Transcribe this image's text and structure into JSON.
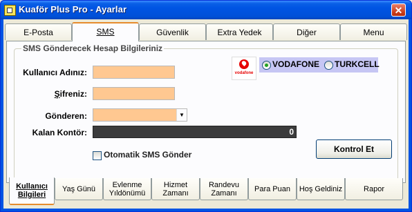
{
  "window": {
    "title": "Kuaför Plus Pro - Ayarlar",
    "close_glyph": "✕"
  },
  "top_tabs": [
    {
      "label": "E-Posta"
    },
    {
      "label": "SMS"
    },
    {
      "label": "Güvenlik"
    },
    {
      "label": "Extra Yedek"
    },
    {
      "label": "Diğer"
    },
    {
      "label": "Menu"
    }
  ],
  "sms": {
    "group_title": "SMS Gönderecek Hesap Bilgileriniz",
    "username_label": "Kullanıcı Adınız:",
    "username_value": "",
    "password_label": "Şifreniz:",
    "password_value": "",
    "sender_label": "Gönderen:",
    "sender_value": "",
    "balance_label": "Kalan Kontör:",
    "balance_value": "0",
    "auto_send_label": "Otomatik SMS Gönder",
    "auto_send_checked": false,
    "operator_logo_text": "vodafone",
    "operators": [
      {
        "label": "VODAFONE",
        "selected": true
      },
      {
        "label": "TURKCELL",
        "selected": false
      }
    ],
    "check_button_label": "Kontrol Et"
  },
  "bottom_tabs": [
    {
      "line1": "Kullanıcı",
      "line2": "Bilgileri"
    },
    {
      "line1": "Yaş Günü",
      "line2": ""
    },
    {
      "line1": "Evlenme",
      "line2": "Yıldönümü"
    },
    {
      "line1": "Hizmet",
      "line2": "Zamanı"
    },
    {
      "line1": "Randevu",
      "line2": "Zamanı"
    },
    {
      "line1": "Para Puan",
      "line2": ""
    },
    {
      "line1": "Hoş Geldiniz",
      "line2": ""
    },
    {
      "line1": "Rapor",
      "line2": ""
    }
  ],
  "colors": {
    "field_bg": "#ffc891",
    "balance_bg": "#3c3c3c",
    "operator_bg": "#c6c6f4",
    "active_tab_accent": "#e68b2c",
    "titlebar": "#0054e3"
  }
}
